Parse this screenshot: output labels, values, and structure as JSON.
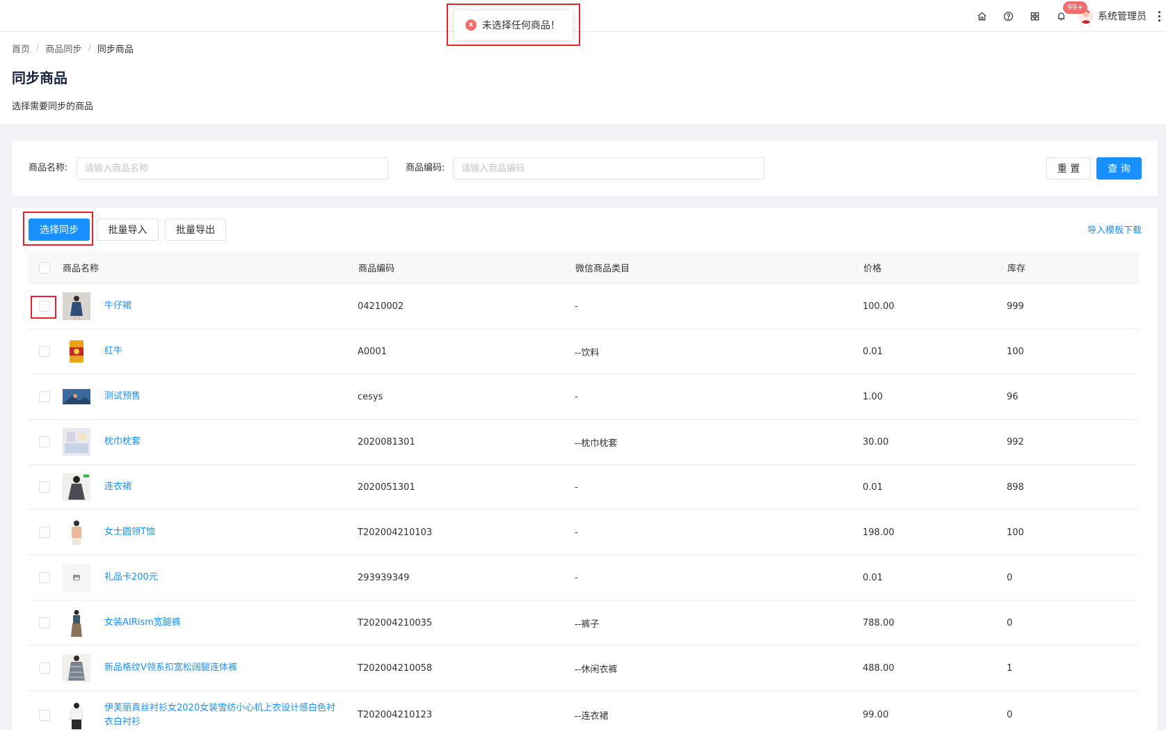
{
  "header": {
    "badge": "99+",
    "user_name": "系统管理员",
    "icons": [
      "home-icon",
      "help-icon",
      "apps-icon",
      "bell-icon"
    ]
  },
  "toast": {
    "message": "未选择任何商品！",
    "type": "error",
    "icon": "x"
  },
  "breadcrumb": {
    "items": [
      "首页",
      "商品同步",
      "同步商品"
    ]
  },
  "page": {
    "title": "同步商品",
    "description": "选择需要同步的商品"
  },
  "search": {
    "name_label": "商品名称:",
    "name_placeholder": "请输入商品名称",
    "code_label": "商品编码:",
    "code_placeholder": "请输入商品编码",
    "reset_label": "重 置",
    "query_label": "查 询"
  },
  "toolbar": {
    "select_sync_label": "选择同步",
    "batch_import_label": "批量导入",
    "batch_export_label": "批量导出",
    "template_link": "导入模板下载"
  },
  "table": {
    "columns": [
      "商品名称",
      "商品编码",
      "微信商品类目",
      "价格",
      "库存"
    ],
    "rows": [
      {
        "name": "牛仔裙",
        "code": "04210002",
        "category": "-",
        "price": "100.00",
        "stock": "999"
      },
      {
        "name": "红牛",
        "code": "A0001",
        "category": "--饮料",
        "price": "0.01",
        "stock": "100"
      },
      {
        "name": "测试预售",
        "code": "cesys",
        "category": "-",
        "price": "1.00",
        "stock": "96"
      },
      {
        "name": "枕巾枕套",
        "code": "2020081301",
        "category": "--枕巾枕套",
        "price": "30.00",
        "stock": "992"
      },
      {
        "name": "连衣裙",
        "code": "2020051301",
        "category": "-",
        "price": "0.01",
        "stock": "898"
      },
      {
        "name": "女士圆领T恤",
        "code": "T202004210103",
        "category": "-",
        "price": "198.00",
        "stock": "100"
      },
      {
        "name": "礼品卡200元",
        "code": "293939349",
        "category": "-",
        "price": "0.01",
        "stock": "0"
      },
      {
        "name": "女装AIRism宽腿裤",
        "code": "T202004210035",
        "category": "--裤子",
        "price": "788.00",
        "stock": "0"
      },
      {
        "name": "新品格纹V领系扣宽松阔腿连体裤",
        "code": "T202004210058",
        "category": "--休闲衣裤",
        "price": "488.00",
        "stock": "1"
      },
      {
        "name": "伊芙丽真丝衬衫女2020女装雪纺小心机上衣设计感白色衬衣白衬衫",
        "code": "T202004210123",
        "category": "--连衣裙",
        "price": "99.00",
        "stock": "0"
      }
    ]
  },
  "colors": {
    "primary": "#1890ff",
    "error": "#f56c6c",
    "highlight_box": "#e8202d"
  }
}
